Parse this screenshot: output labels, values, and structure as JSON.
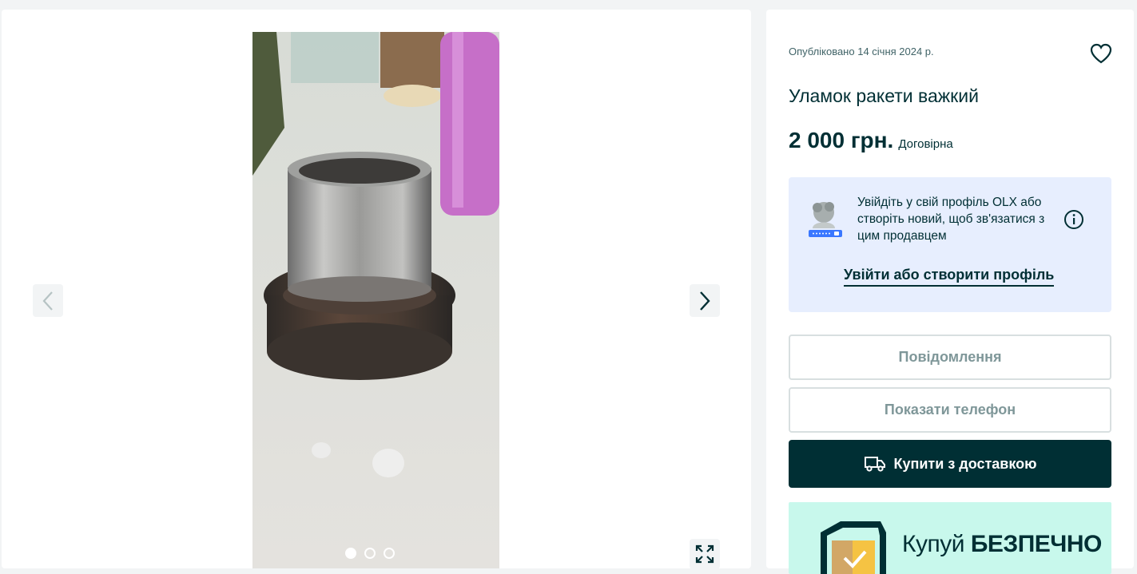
{
  "gallery": {
    "photo_alt": "",
    "nav_prev_icon": "chevron-left-icon",
    "nav_next_icon": "chevron-right-icon",
    "fullscreen_icon": "expand-icon",
    "dots_total": 3,
    "dots_active": 1
  },
  "listing": {
    "published": "Опубліковано 14 січня 2024 р.",
    "title": "Уламок ракети важкий",
    "price": "2 000 грн.",
    "negotiable": "Договірна",
    "favorite_icon": "heart-icon"
  },
  "login_prompt": {
    "text": "Увійдіть у свій профіль OLX або створіть новий, щоб зв'язатися з цим продавцем",
    "link": "Увійти або створити профіль",
    "info_icon": "info-icon"
  },
  "actions": {
    "message": "Повідомлення",
    "show_phone": "Показати телефон",
    "buy_delivery": "Купити з доставкою",
    "buy_icon": "truck-icon"
  },
  "banner": {
    "prefix": "Купуй",
    "emphasis": "БЕЗПЕЧНО"
  },
  "colors": {
    "primary": "#002f34",
    "login_box_bg": "#e7eefe",
    "banner_bg": "#c8f8ec",
    "page_bg": "#f2f4f5"
  }
}
